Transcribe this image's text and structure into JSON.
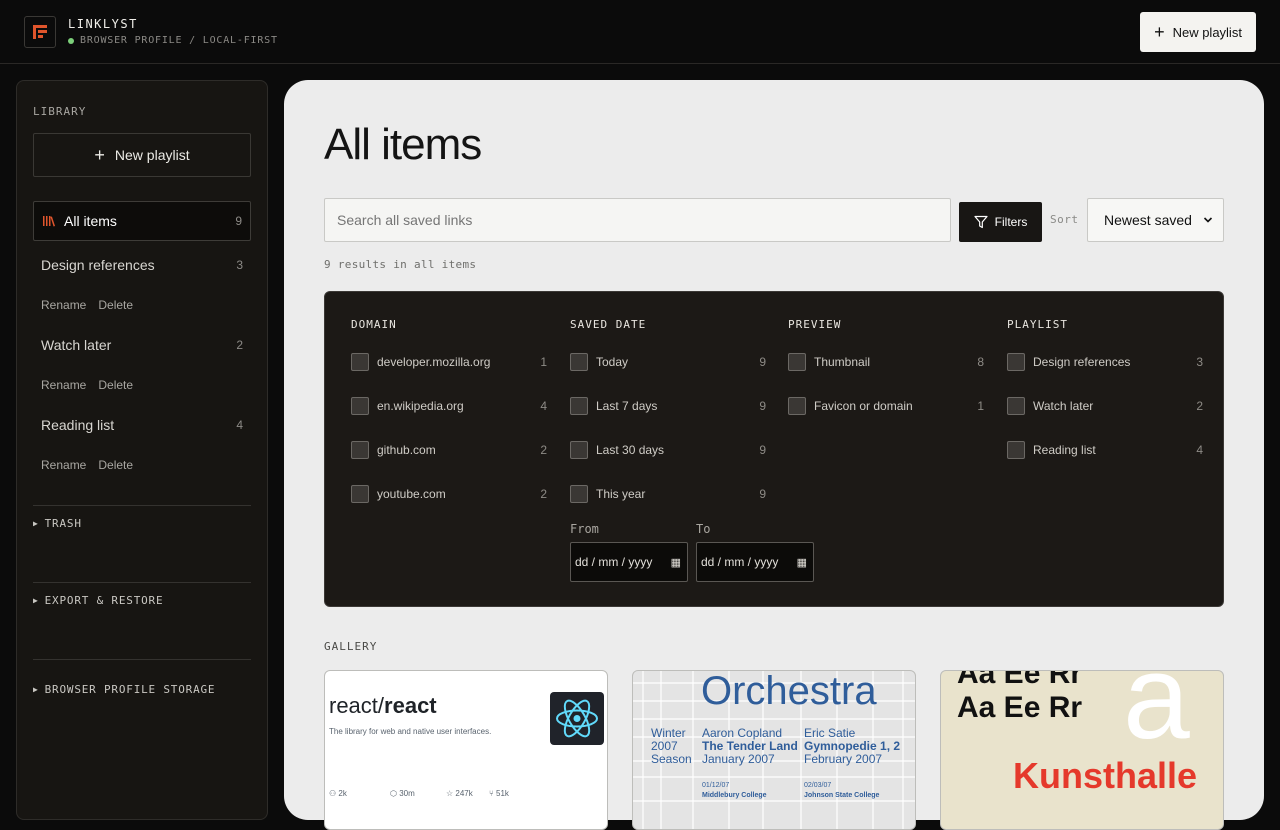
{
  "app": {
    "title": "LINKLYST",
    "subtitle": "BROWSER PROFILE / LOCAL-FIRST",
    "new_playlist_label": "New playlist"
  },
  "sidebar": {
    "library_label": "LIBRARY",
    "new_playlist_label": "New playlist",
    "items": [
      {
        "label": "All items",
        "count": "9"
      },
      {
        "label": "Design references",
        "count": "3"
      },
      {
        "label": "Watch later",
        "count": "2"
      },
      {
        "label": "Reading list",
        "count": "4"
      }
    ],
    "rename_label": "Rename",
    "delete_label": "Delete",
    "trash_label": "TRASH",
    "export_label": "EXPORT & RESTORE",
    "storage_label": "BROWSER PROFILE STORAGE"
  },
  "main": {
    "title": "All items",
    "search_placeholder": "Search all saved links",
    "filters_label": "Filters",
    "sort_label": "Sort",
    "sort_value": "Newest saved",
    "results_text": "9 results in all items",
    "gallery_label": "GALLERY"
  },
  "filters": {
    "domain": {
      "heading": "DOMAIN",
      "options": [
        {
          "label": "developer.mozilla.org",
          "count": "1"
        },
        {
          "label": "en.wikipedia.org",
          "count": "4"
        },
        {
          "label": "github.com",
          "count": "2"
        },
        {
          "label": "youtube.com",
          "count": "2"
        }
      ]
    },
    "saved_date": {
      "heading": "SAVED DATE",
      "options": [
        {
          "label": "Today",
          "count": "9"
        },
        {
          "label": "Last 7 days",
          "count": "9"
        },
        {
          "label": "Last 30 days",
          "count": "9"
        },
        {
          "label": "This year",
          "count": "9"
        }
      ],
      "from_label": "From",
      "to_label": "To",
      "date_placeholder": "dd / mm / yyyy"
    },
    "preview": {
      "heading": "PREVIEW",
      "options": [
        {
          "label": "Thumbnail",
          "count": "8"
        },
        {
          "label": "Favicon or domain",
          "count": "1"
        }
      ]
    },
    "playlist": {
      "heading": "PLAYLIST",
      "options": [
        {
          "label": "Design references",
          "count": "3"
        },
        {
          "label": "Watch later",
          "count": "2"
        },
        {
          "label": "Reading list",
          "count": "4"
        }
      ]
    }
  },
  "gallery": {
    "card1": {
      "repo_owner": "react/",
      "repo_name": "react",
      "description": "The library for web and native user interfaces.",
      "contributors": "2k",
      "used_by": "30m",
      "stars": "247k",
      "forks": "51k"
    },
    "card2": {
      "title": "Orchestra",
      "col1": [
        "Winter",
        "2007",
        "Season"
      ],
      "col2_name": "Aaron Copland",
      "col2_piece": "The Tender Land",
      "col2_date": "January 2007",
      "col3_name": "Eric Satie",
      "col3_piece": "Gymnopedie 1, 2",
      "col3_date": "February 2007",
      "foot1_date": "01/12/07",
      "foot1_place": "Middlebury College",
      "foot2_date": "02/03/07",
      "foot2_place": "Johnson State College"
    },
    "card3": {
      "top_partial": "Aa Ee Rr",
      "sample": "Aa Ee Rr",
      "big_letter": "a",
      "word": "Kunsthalle"
    }
  },
  "colors": {
    "accent": "#e0552c",
    "status_dot": "#7ccf7a",
    "main_bg": "#ececec",
    "panel_bg": "#1c1916",
    "kunsthalle_red": "#e5392b",
    "orchestra_blue": "#2f5d9a"
  }
}
